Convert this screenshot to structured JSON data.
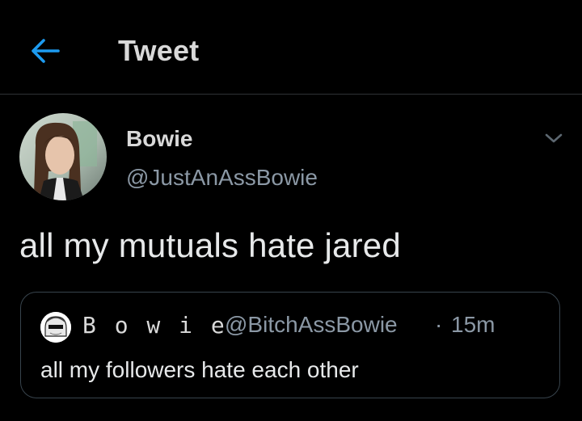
{
  "header": {
    "title": "Tweet",
    "back_icon": "arrow-left-icon"
  },
  "tweet": {
    "author": {
      "display_name": "Bowie",
      "handle": "@JustAnAssBowie",
      "avatar_icon": "profile-photo"
    },
    "menu_icon": "chevron-down-icon",
    "text": "all my mutuals hate jared",
    "quoted": {
      "display_name": "B o w i e",
      "handle": "@BitchAssBowie",
      "separator": "·",
      "time": "15m",
      "text": "all my followers hate each other"
    }
  },
  "colors": {
    "background": "#000000",
    "accent": "#1d9bf0",
    "secondary_text": "#8b98a5",
    "border": "#38444d"
  }
}
